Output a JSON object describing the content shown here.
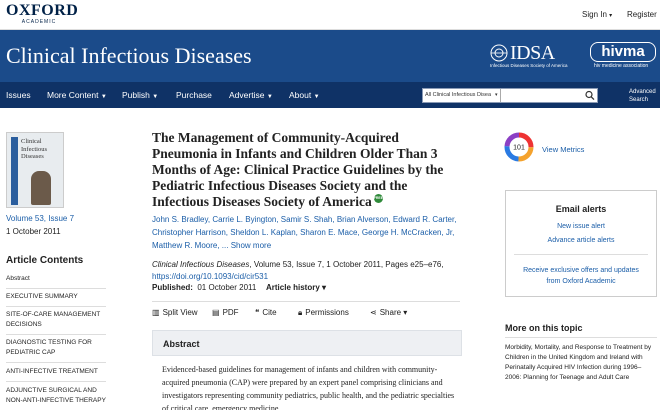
{
  "topbar": {
    "brand": "OXFORD",
    "brand_sub": "ACADEMIC",
    "sign_in": "Sign In",
    "register": "Register"
  },
  "header": {
    "journal_title": "Clinical Infectious Diseases",
    "idsa_logo": "IDSA",
    "idsa_sub": "Infectious Diseases Society of America",
    "hivma_logo": "hivma",
    "hivma_sub": "hiv medicine association"
  },
  "nav": {
    "items": [
      "Issues",
      "More Content",
      "Publish",
      "Purchase",
      "Advertise",
      "About"
    ],
    "search_scope": "All Clinical Infectious Disea",
    "search_placeholder": "",
    "advanced_search": [
      "Advanced",
      "Search"
    ]
  },
  "sidebar": {
    "cover_title": [
      "Clinical",
      "Infectious",
      "Diseases"
    ],
    "volume": "Volume 53, Issue 7",
    "date": "1 October 2011",
    "contents_heading": "Article Contents",
    "toc": [
      "Abstract",
      "EXECUTIVE SUMMARY",
      "SITE-OF-CARE MANAGEMENT DECISIONS",
      "DIAGNOSTIC TESTING FOR PEDIATRIC CAP",
      "ANTI-INFECTIVE TREATMENT",
      "ADJUNCTIVE SURGICAL AND NON-ANTI-INFECTIVE THERAPY"
    ]
  },
  "article": {
    "title": "The Management of Community-Acquired Pneumonia in Infants and Children Older Than 3 Months of Age: Clinical Practice Guidelines by the Pediatric Infectious Diseases Society and the Infectious Diseases Society of America",
    "free_badge": "FREE",
    "authors": "John S. Bradley, Carrie L. Byington, Samir S. Shah, Brian Alverson, Edward R. Carter, Christopher Harrison, Sheldon L. Kaplan, Sharon E. Mace, George H. McCracken, Jr, Matthew R. Moore, ... Show more",
    "journal_name": "Clinical Infectious Diseases",
    "citation_rest": ", Volume 53, Issue 7, 1 October 2011, Pages e25–e76,",
    "doi": "https://doi.org/10.1093/cid/cir531",
    "published_label": "Published:",
    "published_date": "01 October 2011",
    "history": "Article history",
    "tools": {
      "split_view": "Split View",
      "pdf": "PDF",
      "cite": "Cite",
      "permissions": "Permissions",
      "share": "Share"
    },
    "abstract_heading": "Abstract",
    "abstract_text": "Evidenced-based guidelines for management of infants and children with community-acquired pneumonia (CAP) were prepared by an expert panel comprising clinicians and investigators representing community pediatrics, public health, and the pediatric specialties of critical care, emergency medicine,"
  },
  "right": {
    "altmetric_score": "101",
    "view_metrics": "View Metrics",
    "email_heading": "Email alerts",
    "new_issue_alert": "New issue alert",
    "advance_alerts": "Advance article alerts",
    "offers": "Receive exclusive offers and updates from Oxford Academic",
    "more_heading": "More on this topic",
    "more_item": "Morbidity, Mortality, and Response to Treatment by Children in the United Kingdom and Ireland with Perinatally Acquired HIV Infection during 1996–2006: Planning for Teenage and Adult Care"
  }
}
